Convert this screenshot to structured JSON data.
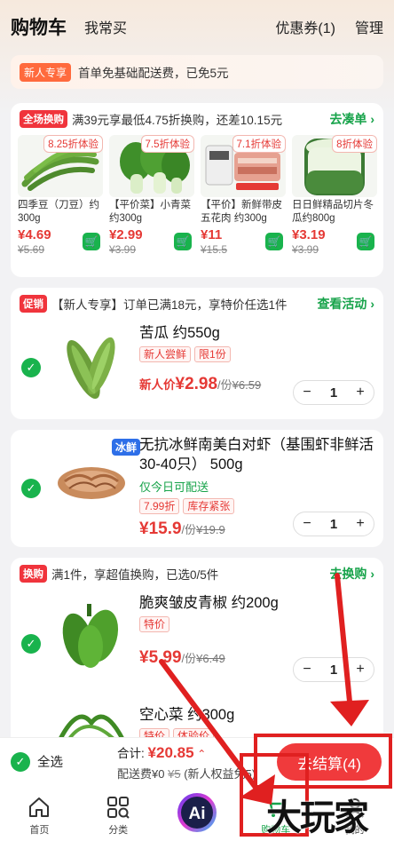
{
  "header": {
    "title": "购物车",
    "often_buy": "我常买",
    "coupon": "优惠券(1)",
    "manage": "管理"
  },
  "new_user_bar": {
    "tag": "新人专享",
    "text": "首单免基础配送费，已免5元"
  },
  "swap_card": {
    "tag": "全场换购",
    "text": "满39元享最低4.75折换购，还差10.15元",
    "link": "去凑单",
    "items": [
      {
        "discount": "8.25折体验",
        "name": "四季豆（刀豆）约300g",
        "price": "¥4.69",
        "orig": "¥5.69",
        "icon": "green-beans"
      },
      {
        "discount": "7.5折体验",
        "name": "【平价菜】小青菜约300g",
        "price": "¥2.99",
        "orig": "¥3.99",
        "icon": "bok-choy"
      },
      {
        "discount": "7.1折体验",
        "name": "【平价】新鲜带皮五花肉 约300g",
        "price": "¥11",
        "orig": "¥15.5",
        "icon": "pork-belly"
      },
      {
        "discount": "8折体验",
        "name": "日日鲜精品切片冬瓜约800g",
        "price": "¥3.19",
        "orig": "¥3.99",
        "icon": "winter-melon"
      }
    ]
  },
  "promo_card": {
    "tag": "促销",
    "text": "【新人专享】订单已满18元，享特价任选1件",
    "link": "查看活动",
    "item": {
      "name": "苦瓜 约550g",
      "tags": [
        "新人尝鲜",
        "限1份"
      ],
      "price_label": "新人价",
      "price": "¥2.98",
      "per": "/份",
      "orig": "¥6.59",
      "qty": "1"
    }
  },
  "shrimp_card": {
    "badge": "冰鲜",
    "name": "无抗冰鲜南美白对虾（基围虾非鲜活30-40只） 500g",
    "note": "仅今日可配送",
    "tags": [
      "7.99折",
      "库存紧张"
    ],
    "price": "¥15.9",
    "per": "/份",
    "orig": "¥19.9",
    "qty": "1"
  },
  "exchange_card": {
    "tag": "换购",
    "text": "满1件，享超值换购，已选0/5件",
    "link": "去换购",
    "items": [
      {
        "name": "脆爽皱皮青椒 约200g",
        "tags": [
          "特价"
        ],
        "price": "¥5.99",
        "per": "/份",
        "orig": "¥6.49",
        "qty": "1"
      },
      {
        "name": "空心菜 约300g",
        "tags": [
          "特价",
          "体验价"
        ]
      }
    ]
  },
  "bottom": {
    "select_all": "全选",
    "total_label": "合计:",
    "total": "¥20.85",
    "fee_label": "配送费¥0",
    "fee_orig": "¥5",
    "fee_note": "(新人权益免5)",
    "checkout": "去结算(4)"
  },
  "tabs": [
    {
      "label": "首页",
      "icon": "home-icon"
    },
    {
      "label": "分类",
      "icon": "category-icon"
    },
    {
      "label": "",
      "icon": "ai-icon"
    },
    {
      "label": "购物车",
      "icon": "cart-icon"
    },
    {
      "label": "我的",
      "icon": "profile-icon"
    }
  ],
  "watermark": "大玩家",
  "colors": {
    "accent_red": "#f03a3c",
    "accent_green": "#19b34d",
    "annotation": "#e02020"
  }
}
